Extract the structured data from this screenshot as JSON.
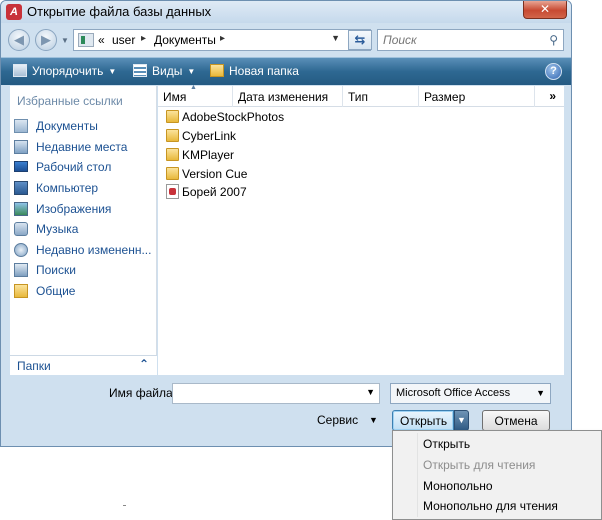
{
  "window": {
    "title": "Открытие файла базы данных",
    "app_icon": "access-icon",
    "close_glyph": "✕"
  },
  "address": {
    "chevron": "«",
    "crumbs": [
      "user",
      "Документы"
    ],
    "separator": "▸"
  },
  "search": {
    "placeholder": "Поиск",
    "icon": "search-icon"
  },
  "toolbar": {
    "organize": "Упорядочить",
    "views": "Виды",
    "new_folder": "Новая папка",
    "help": "?"
  },
  "sidebar": {
    "title": "Избранные ссылки",
    "items": [
      {
        "label": "Документы",
        "icon": "documents-icon"
      },
      {
        "label": "Недавние места",
        "icon": "recent-places-icon"
      },
      {
        "label": "Рабочий стол",
        "icon": "desktop-icon"
      },
      {
        "label": "Компьютер",
        "icon": "computer-icon"
      },
      {
        "label": "Изображения",
        "icon": "pictures-icon"
      },
      {
        "label": "Музыка",
        "icon": "music-icon"
      },
      {
        "label": "Недавно измененн...",
        "icon": "recently-changed-icon"
      },
      {
        "label": "Поиски",
        "icon": "searches-icon"
      },
      {
        "label": "Общие",
        "icon": "public-icon"
      }
    ],
    "folders_label": "Папки",
    "folders_chevron": "⌃"
  },
  "columns": {
    "name": "Имя",
    "modified": "Дата изменения",
    "type": "Тип",
    "size": "Размер",
    "more": "»"
  },
  "files": [
    {
      "name": "AdobeStockPhotos",
      "kind": "folder"
    },
    {
      "name": "CyberLink",
      "kind": "folder"
    },
    {
      "name": "KMPlayer",
      "kind": "folder"
    },
    {
      "name": "Version Cue",
      "kind": "folder"
    },
    {
      "name": "Борей 2007",
      "kind": "database"
    }
  ],
  "footer": {
    "filename_label": "Имя файла:",
    "filename_value": "",
    "filetype": "Microsoft Office Access",
    "tools": "Сервис",
    "open": "Открыть",
    "cancel": "Отмена"
  },
  "open_menu": {
    "items": [
      {
        "label": "Открыть",
        "enabled": true
      },
      {
        "label": "Открыть для чтения",
        "enabled": false
      },
      {
        "label": "Монопольно",
        "enabled": true
      },
      {
        "label": "Монопольно для чтения",
        "enabled": true
      }
    ]
  },
  "colors": {
    "toolbar": "#2e6892",
    "link": "#1c5192",
    "frame": "#cfe0ef"
  }
}
